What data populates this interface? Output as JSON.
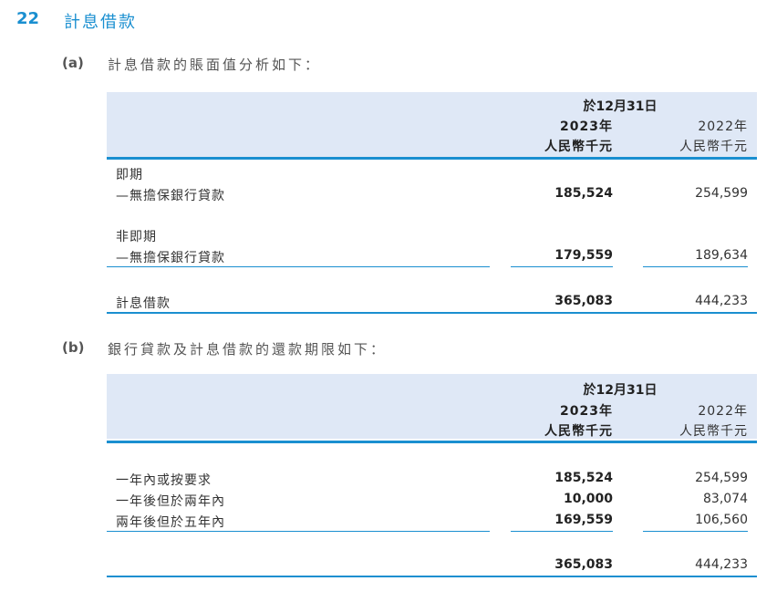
{
  "section": {
    "number": "22",
    "title": "計息借款"
  },
  "part_a": {
    "letter": "(a)",
    "heading": "計息借款的賬面值分析如下：",
    "header": {
      "period": "於12月31日",
      "year_current": "2023年",
      "year_prior": "2022年",
      "unit_current": "人民幣千元",
      "unit_prior": "人民幣千元"
    },
    "current_label": "即期",
    "current_item": {
      "label": "—無擔保銀行貸款",
      "v2023": "185,524",
      "v2022": "254,599"
    },
    "noncurrent_label": "非即期",
    "noncurrent_item": {
      "label": "—無擔保銀行貸款",
      "v2023": "179,559",
      "v2022": "189,634"
    },
    "total": {
      "label": "計息借款",
      "v2023": "365,083",
      "v2022": "444,233"
    }
  },
  "part_b": {
    "letter": "(b)",
    "heading": "銀行貸款及計息借款的還款期限如下：",
    "header": {
      "period": "於12月31日",
      "year_current": "2023年",
      "year_prior": "2022年",
      "unit_current": "人民幣千元",
      "unit_prior": "人民幣千元"
    },
    "rows": [
      {
        "label": "一年內或按要求",
        "v2023": "185,524",
        "v2022": "254,599"
      },
      {
        "label": "一年後但於兩年內",
        "v2023": "10,000",
        "v2022": "83,074"
      },
      {
        "label": "兩年後但於五年內",
        "v2023": "169,559",
        "v2022": "106,560"
      }
    ],
    "total": {
      "v2023": "365,083",
      "v2022": "444,233"
    }
  }
}
